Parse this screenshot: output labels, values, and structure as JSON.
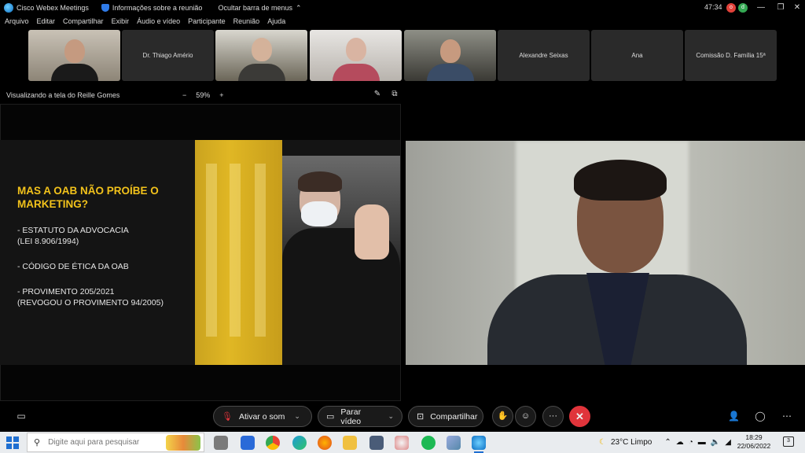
{
  "window": {
    "app_name": "Cisco Webex Meetings",
    "meeting_info": "Informações sobre a reunião",
    "hide_menu": "Ocultar barra de menus",
    "timer": "47:34",
    "badges": [
      "o",
      "d"
    ]
  },
  "menu": [
    "Arquivo",
    "Editar",
    "Compartilhar",
    "Exibir",
    "Áudio e vídeo",
    "Participante",
    "Reunião",
    "Ajuda"
  ],
  "participants": [
    {
      "name": "",
      "has_video": true
    },
    {
      "name": "Dr. Thiago Amério",
      "has_video": false
    },
    {
      "name": "",
      "has_video": true
    },
    {
      "name": "",
      "has_video": true
    },
    {
      "name": "",
      "has_video": true
    },
    {
      "name": "Alexandre Seixas",
      "has_video": false
    },
    {
      "name": "Ana",
      "has_video": false
    },
    {
      "name": "Comissão D. Família 15ª",
      "has_video": false
    }
  ],
  "share": {
    "label": "Visualizando a tela do Reille Gomes",
    "zoom": "59%",
    "zoom_out": "−",
    "zoom_in": "+"
  },
  "slide": {
    "title": "MAS A OAB NÃO PROÍBE O MARKETING?",
    "bullets": [
      "- ESTATUTO DA ADVOCACIA\n(LEI 8.906/1994)",
      "- CÓDIGO DE ÉTICA DA OAB",
      "- PROVIMENTO 205/2021\n(REVOGOU O PROVIMENTO 94/2005)"
    ],
    "colors": {
      "accent": "#f2c21b",
      "background": "#141414"
    }
  },
  "controls": {
    "mute": "Ativar o som",
    "video": "Parar vídeo",
    "share": "Compartilhar",
    "more": "···",
    "leave": "✕"
  },
  "taskbar": {
    "search_placeholder": "Digite aqui para pesquisar",
    "weather": "23°C  Limpo",
    "time": "18:29",
    "date": "22/06/2022",
    "notifications": "3"
  }
}
